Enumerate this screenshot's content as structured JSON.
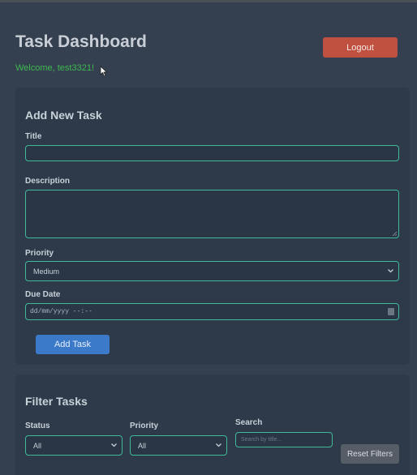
{
  "header": {
    "title": "Task Dashboard",
    "welcome": "Welcome, test3321!",
    "logout_label": "Logout"
  },
  "add_task": {
    "heading": "Add New Task",
    "title_label": "Title",
    "title_value": "",
    "description_label": "Description",
    "description_value": "",
    "priority_label": "Priority",
    "priority_value": "Medium",
    "due_date_label": "Due Date",
    "due_date_placeholder": "dd/mm/yyyy --:--",
    "submit_label": "Add Task"
  },
  "filter": {
    "heading": "Filter Tasks",
    "status_label": "Status",
    "status_value": "All",
    "priority_label": "Priority",
    "priority_value": "All",
    "search_label": "Search",
    "search_placeholder": "Search by title...",
    "reset_label": "Reset Filters"
  },
  "colors": {
    "background": "#34404f",
    "card": "#2e3a4a",
    "accent_border": "#3fb99a",
    "welcome_text": "#3fb950",
    "logout": "#c0503f",
    "add_button": "#3a7ac8",
    "reset_button": "#565d66"
  }
}
